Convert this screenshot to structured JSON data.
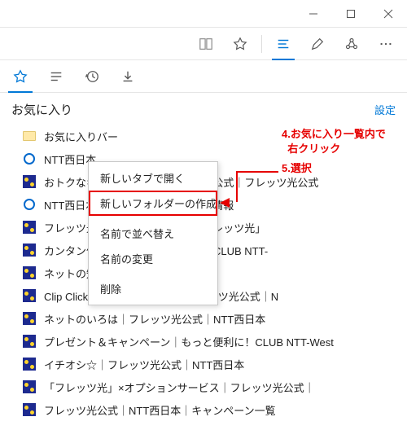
{
  "pane": {
    "title": "お気に入り",
    "settings": "設定"
  },
  "favorites": {
    "items": [
      {
        "icon": "folder",
        "label": "お気に入りバー"
      },
      {
        "icon": "ntt-o",
        "label": "NTT西日本"
      },
      {
        "icon": "ntt-sq",
        "label": "おトクなキャンペーン｜フレッツ光公式｜フレッツ光公式"
      },
      {
        "icon": "ntt-o",
        "label": "NTT西日本｜フレッツ光・サポート情報"
      },
      {
        "icon": "ntt-sq",
        "label": "フレッツ光公式｜NTT西日本の「フレッツ光」"
      },
      {
        "icon": "ntt-sq",
        "label": "カンタン便利な無料会員制アプリ「CLUB NTT-"
      },
      {
        "icon": "ntt-sq",
        "label": "ネットの知恵袋｜NTT西日本"
      },
      {
        "icon": "ntt-sq",
        "label": "Clip Click クリップクリック｜フレッツ光公式｜N"
      },
      {
        "icon": "ntt-sq",
        "label": "ネットのいろは｜フレッツ光公式｜NTT西日本"
      },
      {
        "icon": "ntt-sq",
        "label": "プレゼント＆キャンペーン｜もっと便利に！CLUB NTT-West"
      },
      {
        "icon": "ntt-sq",
        "label": "イチオシ☆｜フレッツ光公式｜NTT西日本"
      },
      {
        "icon": "ntt-sq",
        "label": "「フレッツ光」×オプションサービス｜フレッツ光公式｜"
      },
      {
        "icon": "ntt-sq",
        "label": "フレッツ光公式｜NTT西日本｜キャンペーン一覧"
      }
    ]
  },
  "context_menu": {
    "items": [
      "新しいタブで開く",
      "新しいフォルダーの作成",
      "名前で並べ替え",
      "名前の変更",
      "削除"
    ],
    "highlight_index": 1
  },
  "callouts": {
    "step4_line1": "4.お気に入り一覧内で",
    "step4_line2": "右クリック",
    "step5": "5.選択"
  }
}
